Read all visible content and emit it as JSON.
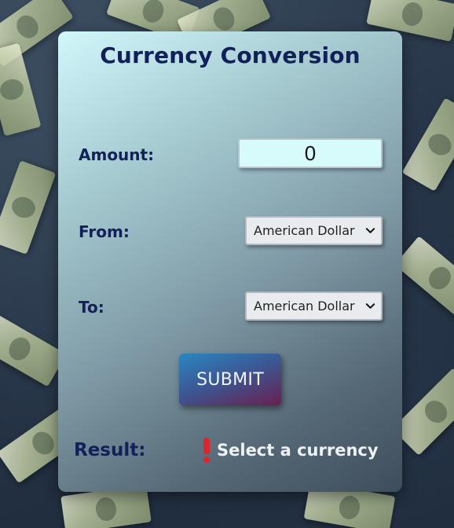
{
  "card": {
    "title": "Currency Conversion"
  },
  "amount": {
    "label": "Amount:",
    "value": "0"
  },
  "from": {
    "label": "From:",
    "selected": "American Dollar"
  },
  "to": {
    "label": "To:",
    "selected": "American Dollar"
  },
  "submit": {
    "label": "SUBMIT"
  },
  "result": {
    "label": "Result:",
    "message": "Select a currency",
    "icon": "exclamation-icon"
  },
  "colors": {
    "heading": "#13205a",
    "alert": "#e0242a",
    "input_bg": "#d7fbfb"
  }
}
